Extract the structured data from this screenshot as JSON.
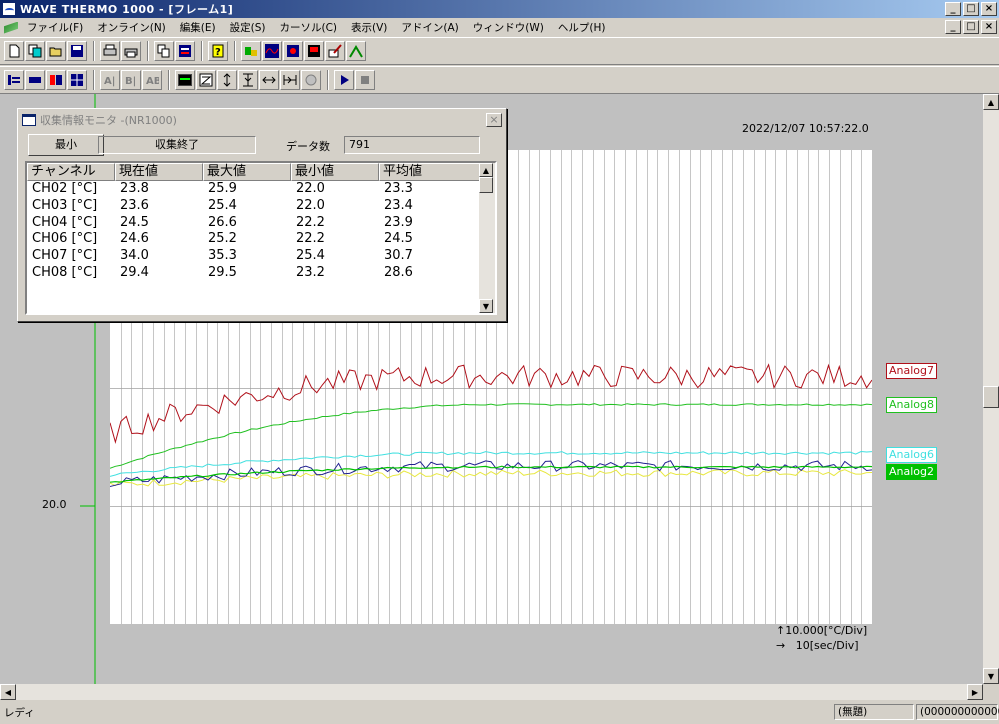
{
  "app": {
    "title": "WAVE THERMO 1000 - [フレーム1]",
    "caption_min": "_",
    "caption_max": "□",
    "caption_close": "×"
  },
  "menu": [
    "ファイル(F)",
    "オンライン(N)",
    "編集(E)",
    "設定(S)",
    "カーソル(C)",
    "表示(V)",
    "アドイン(A)",
    "ウィンドウ(W)",
    "ヘルプ(H)"
  ],
  "toolbar1_icons": [
    "new-icon",
    "copy-icon",
    "open-icon",
    "save-icon",
    "print-icon",
    "print-preview-icon",
    "copy-image-icon",
    "properties-icon",
    "help-icon",
    "connect-icon",
    "waveform-icon",
    "record-icon",
    "save-data-icon",
    "edit-icon",
    "settings-icon"
  ],
  "toolbar2_icons": [
    "channel-list-icon",
    "channel-bar-icon",
    "channel-select-icon",
    "grid-icon",
    "zoom-a-icon",
    "zoom-b-icon",
    "zoom-c-icon",
    "wave-view-icon",
    "z-icon",
    "v-expand-icon",
    "v-fit-icon",
    "h-expand-icon",
    "h-fit-icon",
    "target-icon",
    "play-icon",
    "stop-icon"
  ],
  "chart": {
    "timestamp": "2022/12/07 10:57:22.0",
    "y_tick_label": "20.0",
    "scale_y": "↑10.000[°C/Div]",
    "scale_x": "→   10[sec/Div]",
    "colors": {
      "analog7": "#b0101a",
      "analog8": "#20c020",
      "analog6": "#40e0e0",
      "analog2": "#00c000",
      "yellow": "#e8e840",
      "navy": "#202090",
      "grid": "#a0a0a0"
    }
  },
  "chart_data": {
    "type": "line",
    "series": [
      {
        "name": "Analog7",
        "start": 26.2,
        "end": 31.0
      },
      {
        "name": "Analog8",
        "start": 23.2,
        "end": 28.6
      },
      {
        "name": "Analog6",
        "start": 22.6,
        "end": 24.5
      },
      {
        "name": "Analog2",
        "start": 22.0,
        "end": 23.3
      }
    ],
    "y_per_div": 10.0,
    "x_per_div": 10,
    "grid": true
  },
  "monitor": {
    "title": "収集情報モニタ  -(NR1000)",
    "close": "×",
    "min_button": "最小",
    "status": "収集終了",
    "data_count_label": "データ数",
    "data_count": "791",
    "headers": [
      "チャンネル",
      "現在値",
      "最大値",
      "最小値",
      "平均値"
    ],
    "rows": [
      [
        "CH02 [°C]",
        "23.8",
        "25.9",
        "22.0",
        "23.3"
      ],
      [
        "CH03 [°C]",
        "23.6",
        "25.4",
        "22.0",
        "23.4"
      ],
      [
        "CH04 [°C]",
        "24.5",
        "26.6",
        "22.2",
        "23.9"
      ],
      [
        "CH06 [°C]",
        "24.6",
        "25.2",
        "22.2",
        "24.5"
      ],
      [
        "CH07 [°C]",
        "34.0",
        "35.3",
        "25.4",
        "30.7"
      ],
      [
        "CH08 [°C]",
        "29.4",
        "29.5",
        "23.2",
        "28.6"
      ]
    ]
  },
  "status": {
    "ready": "レディ",
    "doc": "(無題)",
    "counter": "(000000000000)"
  }
}
